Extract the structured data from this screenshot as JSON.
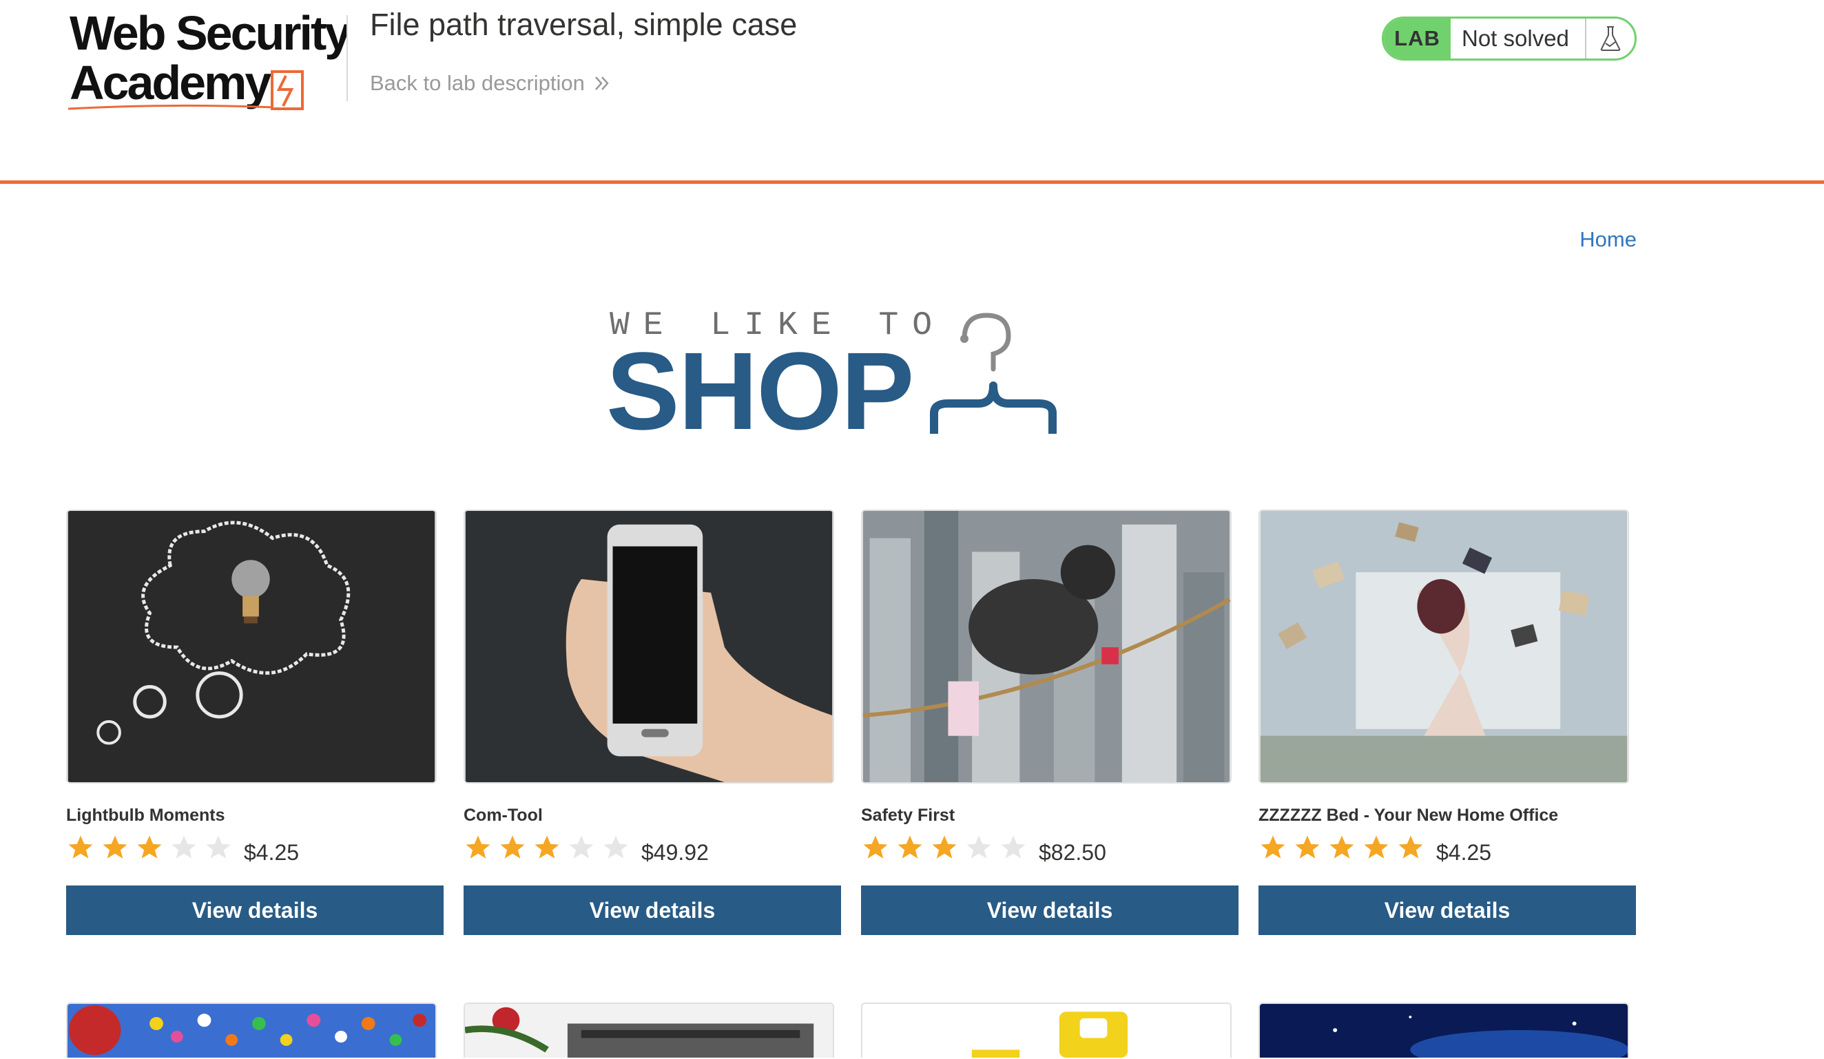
{
  "header": {
    "logo_text_line1": "Web Security",
    "logo_text_line2": "Academy",
    "lab_title": "File path traversal, simple case",
    "back_link": "Back to lab description",
    "status": {
      "badge": "LAB",
      "text": "Not solved",
      "icon": "flask-icon"
    }
  },
  "nav": {
    "home": "Home"
  },
  "banner": {
    "top_text": "WE LIKE TO",
    "main_text": "SHOP",
    "icon": "hanger-icon"
  },
  "colors": {
    "accent": "#ec6a37",
    "primary": "#285b86",
    "lab_green": "#70d16d",
    "star": "#f5a623",
    "link": "#2f76c2"
  },
  "products": [
    {
      "name": "Lightbulb Moments",
      "rating": 3,
      "price": "$4.25",
      "button": "View details",
      "image": "lightbulb-chalkboard-image"
    },
    {
      "name": "Com-Tool",
      "rating": 3,
      "price": "$49.92",
      "button": "View details",
      "image": "smartphone-in-hand-image"
    },
    {
      "name": "Safety First",
      "rating": 3,
      "price": "$82.50",
      "button": "View details",
      "image": "child-on-tightrope-image"
    },
    {
      "name": "ZZZZZZ Bed - Your New Home Office",
      "rating": 5,
      "price": "$4.25",
      "button": "View details",
      "image": "flying-books-bedroom-image"
    }
  ],
  "products_row2": [
    {
      "image": "balloons-image"
    },
    {
      "image": "typewriter-flowers-image"
    },
    {
      "image": "yellow-object-image"
    },
    {
      "image": "blue-space-image"
    }
  ]
}
